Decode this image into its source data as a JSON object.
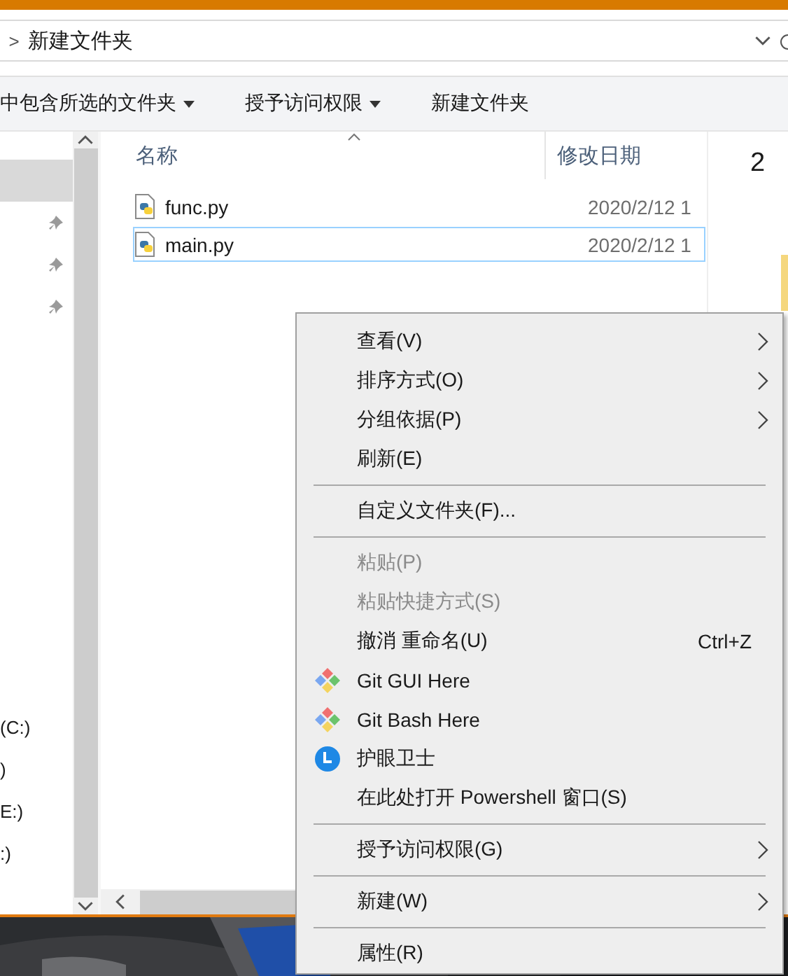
{
  "address_bar": {
    "separator": ">",
    "path": "新建文件夹"
  },
  "toolbar": [
    {
      "label": "中包含所选的文件夹",
      "dropdown": true
    },
    {
      "label": "授予访问权限",
      "dropdown": true
    },
    {
      "label": "新建文件夹",
      "dropdown": false
    }
  ],
  "nav_pane": [
    {
      "kind": "blank",
      "selected": true
    },
    {
      "kind": "pinned",
      "selected": false
    },
    {
      "kind": "pinned",
      "selected": false
    },
    {
      "kind": "pinned",
      "selected": false
    },
    {
      "kind": "drive",
      "label": "(C:)",
      "selected": false
    },
    {
      "kind": "drive",
      "label": ")",
      "selected": false
    },
    {
      "kind": "drive",
      "label": "E:)",
      "selected": false
    },
    {
      "kind": "drive",
      "label": ":)",
      "selected": false
    }
  ],
  "columns": [
    "名称",
    "修改日期"
  ],
  "files": [
    {
      "name": "func.py",
      "date": "2020/2/12 1",
      "selected": false
    },
    {
      "name": "main.py",
      "date": "2020/2/12 1",
      "selected": true
    }
  ],
  "preview": {
    "text": "2"
  },
  "context_menu": [
    {
      "kind": "item",
      "label": "查看(V)",
      "submenu": true,
      "disabled": false
    },
    {
      "kind": "item",
      "label": "排序方式(O)",
      "submenu": true,
      "disabled": false
    },
    {
      "kind": "item",
      "label": "分组依据(P)",
      "submenu": true,
      "disabled": false
    },
    {
      "kind": "item",
      "label": "刷新(E)",
      "submenu": false,
      "disabled": false
    },
    {
      "kind": "separator"
    },
    {
      "kind": "item",
      "label": "自定义文件夹(F)...",
      "submenu": false,
      "disabled": false
    },
    {
      "kind": "separator"
    },
    {
      "kind": "item",
      "label": "粘贴(P)",
      "submenu": false,
      "disabled": true
    },
    {
      "kind": "item",
      "label": "粘贴快捷方式(S)",
      "submenu": false,
      "disabled": true
    },
    {
      "kind": "item",
      "label": "撤消 重命名(U)",
      "shortcut": "Ctrl+Z",
      "submenu": false,
      "disabled": false
    },
    {
      "kind": "git",
      "label": "Git GUI Here",
      "submenu": false,
      "disabled": false
    },
    {
      "kind": "git",
      "label": "Git Bash Here",
      "submenu": false,
      "disabled": false
    },
    {
      "kind": "clock",
      "label": "护眼卫士",
      "submenu": false,
      "disabled": false
    },
    {
      "kind": "item",
      "label": "在此处打开 Powershell 窗口(S)",
      "submenu": false,
      "disabled": false
    },
    {
      "kind": "separator"
    },
    {
      "kind": "item",
      "label": "授予访问权限(G)",
      "submenu": true,
      "disabled": false
    },
    {
      "kind": "separator"
    },
    {
      "kind": "item",
      "label": "新建(W)",
      "submenu": true,
      "disabled": false
    },
    {
      "kind": "separator"
    },
    {
      "kind": "item",
      "label": "属性(R)",
      "submenu": false,
      "disabled": false
    }
  ]
}
